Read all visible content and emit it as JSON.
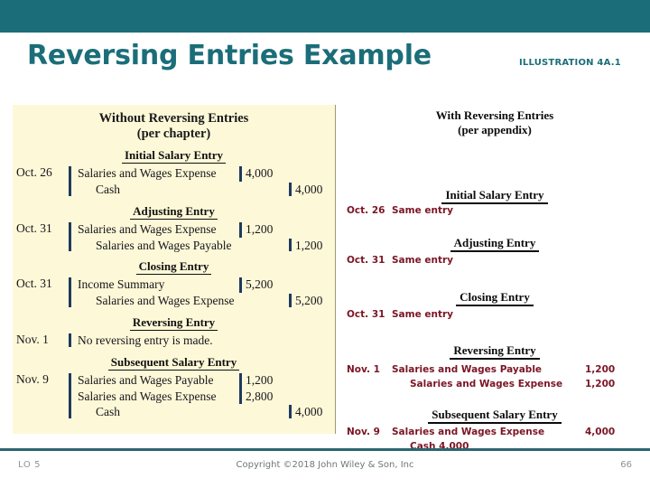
{
  "slide": {
    "title": "Reversing Entries Example",
    "illustration_label": "ILLUSTRATION 4A.1",
    "accent_teal": "#1b6e79",
    "panel_yellow": "#fdf8d8",
    "maroon": "#7b1525"
  },
  "left_panel": {
    "heading_line1": "Without Reversing Entries",
    "heading_line2": "(per chapter)",
    "sections": [
      {
        "title": "Initial Salary Entry",
        "date": "Oct. 26",
        "lines": [
          {
            "account": "Salaries and Wages Expense",
            "indent": 0,
            "debit": "4,000",
            "credit": ""
          },
          {
            "account": "Cash",
            "indent": 1,
            "debit": "",
            "credit": "4,000"
          }
        ]
      },
      {
        "title": "Adjusting Entry",
        "date": "Oct. 31",
        "lines": [
          {
            "account": "Salaries and Wages Expense",
            "indent": 0,
            "debit": "1,200",
            "credit": ""
          },
          {
            "account": "Salaries and Wages Payable",
            "indent": 1,
            "debit": "",
            "credit": "1,200"
          }
        ]
      },
      {
        "title": "Closing Entry",
        "date": "Oct. 31",
        "lines": [
          {
            "account": "Income Summary",
            "indent": 0,
            "debit": "5,200",
            "credit": ""
          },
          {
            "account": "Salaries and Wages Expense",
            "indent": 1,
            "debit": "",
            "credit": "5,200"
          }
        ]
      },
      {
        "title": "Reversing Entry",
        "date": "Nov. 1",
        "note": "No reversing entry is made.",
        "lines": []
      },
      {
        "title": "Subsequent Salary Entry",
        "date": "Nov. 9",
        "lines": [
          {
            "account": "Salaries and Wages Payable",
            "indent": 0,
            "debit": "1,200",
            "credit": ""
          },
          {
            "account": "Salaries and Wages Expense",
            "indent": 0,
            "debit": "2,800",
            "credit": ""
          },
          {
            "account": "Cash",
            "indent": 1,
            "debit": "",
            "credit": "4,000"
          }
        ]
      }
    ]
  },
  "right_panel": {
    "heading_line1": "With Reversing Entries",
    "heading_line2": "(per appendix)",
    "sections": [
      {
        "title": "Initial Salary Entry",
        "date": "Oct. 26",
        "rows": [
          {
            "account": "Same entry",
            "indent": 0,
            "amount": ""
          }
        ]
      },
      {
        "title": "Adjusting Entry",
        "date": "Oct. 31",
        "rows": [
          {
            "account": "Same entry",
            "indent": 0,
            "amount": ""
          }
        ]
      },
      {
        "title": "Closing Entry",
        "date": "Oct. 31",
        "rows": [
          {
            "account": "Same entry",
            "indent": 0,
            "amount": ""
          }
        ]
      },
      {
        "title": "Reversing Entry",
        "date": "Nov. 1",
        "rows": [
          {
            "account": "Salaries and Wages Payable",
            "indent": 0,
            "amount": "1,200"
          },
          {
            "account": "Salaries and Wages Expense",
            "indent": 1,
            "amount": "1,200"
          }
        ]
      },
      {
        "title": "Subsequent Salary Entry",
        "date": "Nov. 9",
        "rows": [
          {
            "account": "Salaries and Wages Expense",
            "indent": 0,
            "amount": "4,000"
          },
          {
            "account": "Cash  4,000",
            "indent": 1,
            "amount": ""
          }
        ]
      }
    ]
  },
  "footer": {
    "learning_objective": "LO 5",
    "copyright": "Copyright ©2018 John Wiley & Son, Inc",
    "page_number": "66"
  }
}
